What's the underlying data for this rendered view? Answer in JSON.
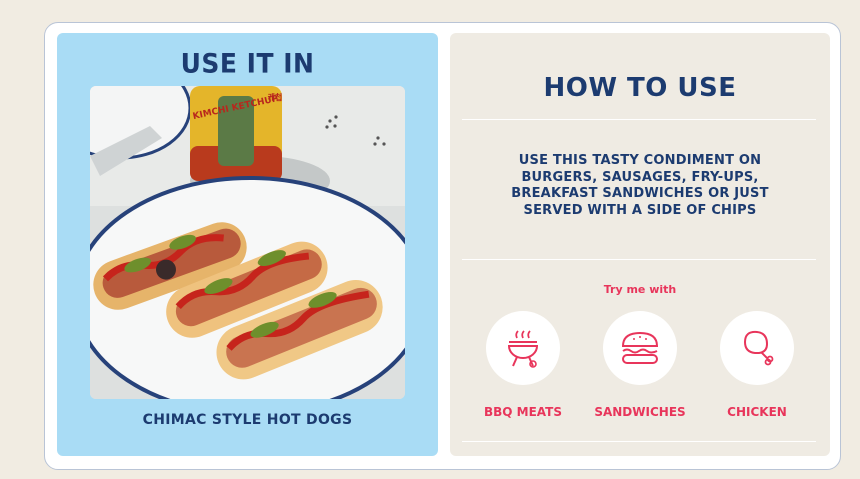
{
  "use_it_in": {
    "title": "USE IT IN",
    "caption": "CHIMAC STYLE HOT DOGS",
    "bottle_label": "KIMCHI KETCHUP",
    "bottle_korean": "케첩"
  },
  "how_to_use": {
    "title": "HOW TO USE",
    "description": "USE THIS TASTY CONDIMENT ON BURGERS, SAUSAGES, FRY-UPS, BREAKFAST SANDWICHES OR JUST SERVED WITH A SIDE OF CHIPS",
    "try_label": "Try me with",
    "pairings": [
      {
        "label": "BBQ MEATS",
        "icon": "bbq-grill-icon"
      },
      {
        "label": "SANDWICHES",
        "icon": "sandwich-icon"
      },
      {
        "label": "CHICKEN",
        "icon": "chicken-leg-icon"
      }
    ]
  },
  "colors": {
    "background": "#f1ece2",
    "left_panel": "#a9dcf5",
    "right_panel": "#efebe3",
    "navy": "#1c3b70",
    "accent_pink": "#e8355b"
  }
}
